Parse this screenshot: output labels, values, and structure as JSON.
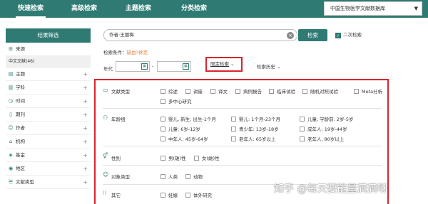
{
  "nav": {
    "tabs": [
      "快速检索",
      "高级检索",
      "主题检索",
      "分类检索"
    ],
    "database": "中国生物医学文献数据库"
  },
  "sidebar": {
    "header": "结果筛选",
    "items": [
      {
        "label": "来源",
        "icon": "source-icon"
      },
      {
        "label": "主题",
        "icon": "topic-icon"
      },
      {
        "label": "学科",
        "icon": "subject-icon"
      },
      {
        "label": "时间",
        "icon": "clock-icon"
      },
      {
        "label": "期刊",
        "icon": "journal-icon"
      },
      {
        "label": "作者",
        "icon": "person-icon"
      },
      {
        "label": "机构",
        "icon": "org-icon"
      },
      {
        "label": "基金",
        "icon": "fund-icon"
      },
      {
        "label": "地区",
        "icon": "region-icon"
      },
      {
        "label": "文献类型",
        "icon": "doctype-icon"
      }
    ],
    "source_sub": "中文文献(46)"
  },
  "search": {
    "value": "作者:王丽梅",
    "button": "检索",
    "secondary_label": "二次检索"
  },
  "condition": {
    "label": "检索条件：",
    "value": "缺血?休克"
  },
  "year": {
    "label": "年代",
    "dash": "-"
  },
  "limit_button": "限定检索",
  "history_button": "检索历史",
  "filters": {
    "doc_type": {
      "title": "文献类型",
      "options": [
        "综述",
        "讲座",
        "译文",
        "病例报告",
        "临床试验",
        "随机对照试验",
        "Meta分析",
        "多中心研究"
      ]
    },
    "age": {
      "title": "年龄组",
      "options": [
        "婴儿, 新生: 出生-1个月",
        "婴儿: 1个月-23个月",
        "儿童, 学龄前: 2岁-5岁",
        "儿童: 6岁-12岁",
        "青少年: 13岁-18岁",
        "成年人: 19岁-44岁",
        "中年人: 45岁-64岁",
        "老年人: 65岁以上",
        "老年人, 80岁以上"
      ]
    },
    "gender": {
      "title": "性别",
      "options": [
        "男(雄)性",
        "女(雌)性"
      ]
    },
    "subject": {
      "title": "对象类型",
      "options": [
        "人类",
        "动物"
      ]
    },
    "other": {
      "title": "其它",
      "options": [
        "妊娠",
        "体外研究"
      ]
    }
  },
  "watermark": "知乎 @每天要能量满满呀"
}
